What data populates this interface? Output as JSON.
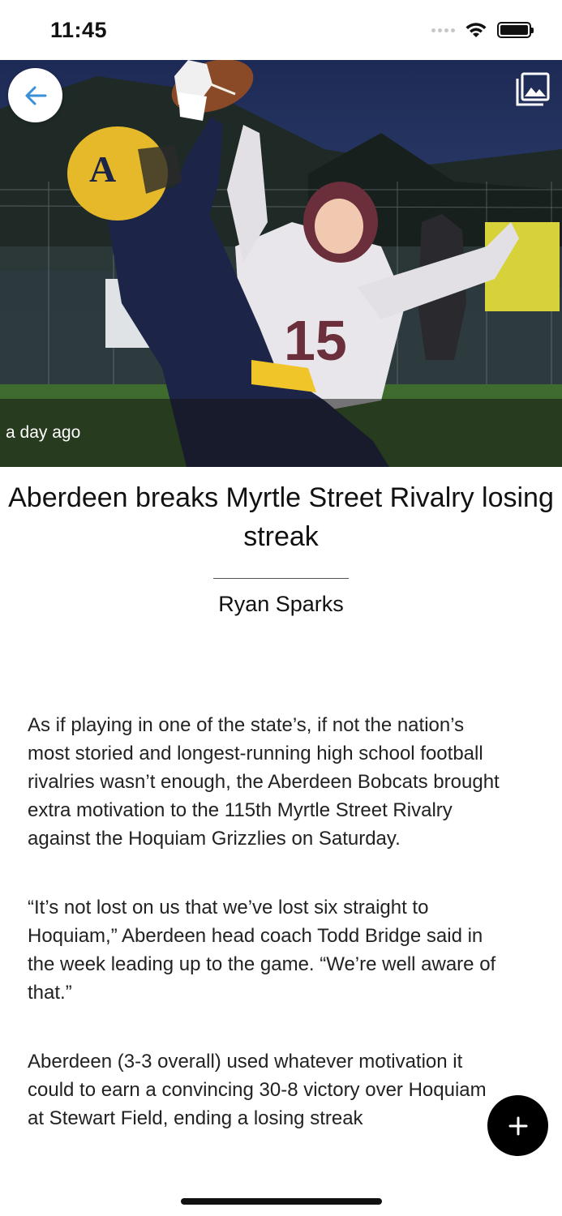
{
  "status_bar": {
    "time": "11:45"
  },
  "hero": {
    "timestamp": "a day ago",
    "back_icon": "arrow-left-icon",
    "gallery_icon": "image-gallery-icon"
  },
  "article": {
    "headline": "Aberdeen breaks Myrtle Street Rivalry losing streak",
    "author": "Ryan Sparks",
    "paragraphs": [
      "As if playing in one of the state’s, if not the nation’s most storied and longest-running high school football rivalries wasn’t enough, the Aberdeen Bobcats brought extra motivation to the 115th Myrtle Street Rivalry against the Hoquiam Grizzlies on Saturday.",
      "“It’s not lost on us that we’ve lost six straight to Hoquiam,” Aberdeen head coach Todd Bridge said in the week leading up to the game. “We’re well aware of that.”",
      "Aberdeen (3-3 overall) used whatever motivation it could to earn a convincing 30-8 victory over Hoquiam at Stewart Field, ending a losing streak"
    ]
  },
  "fab": {
    "icon": "plus-icon"
  },
  "colors": {
    "accent": "#3a8fd6",
    "fab": "#000000"
  }
}
